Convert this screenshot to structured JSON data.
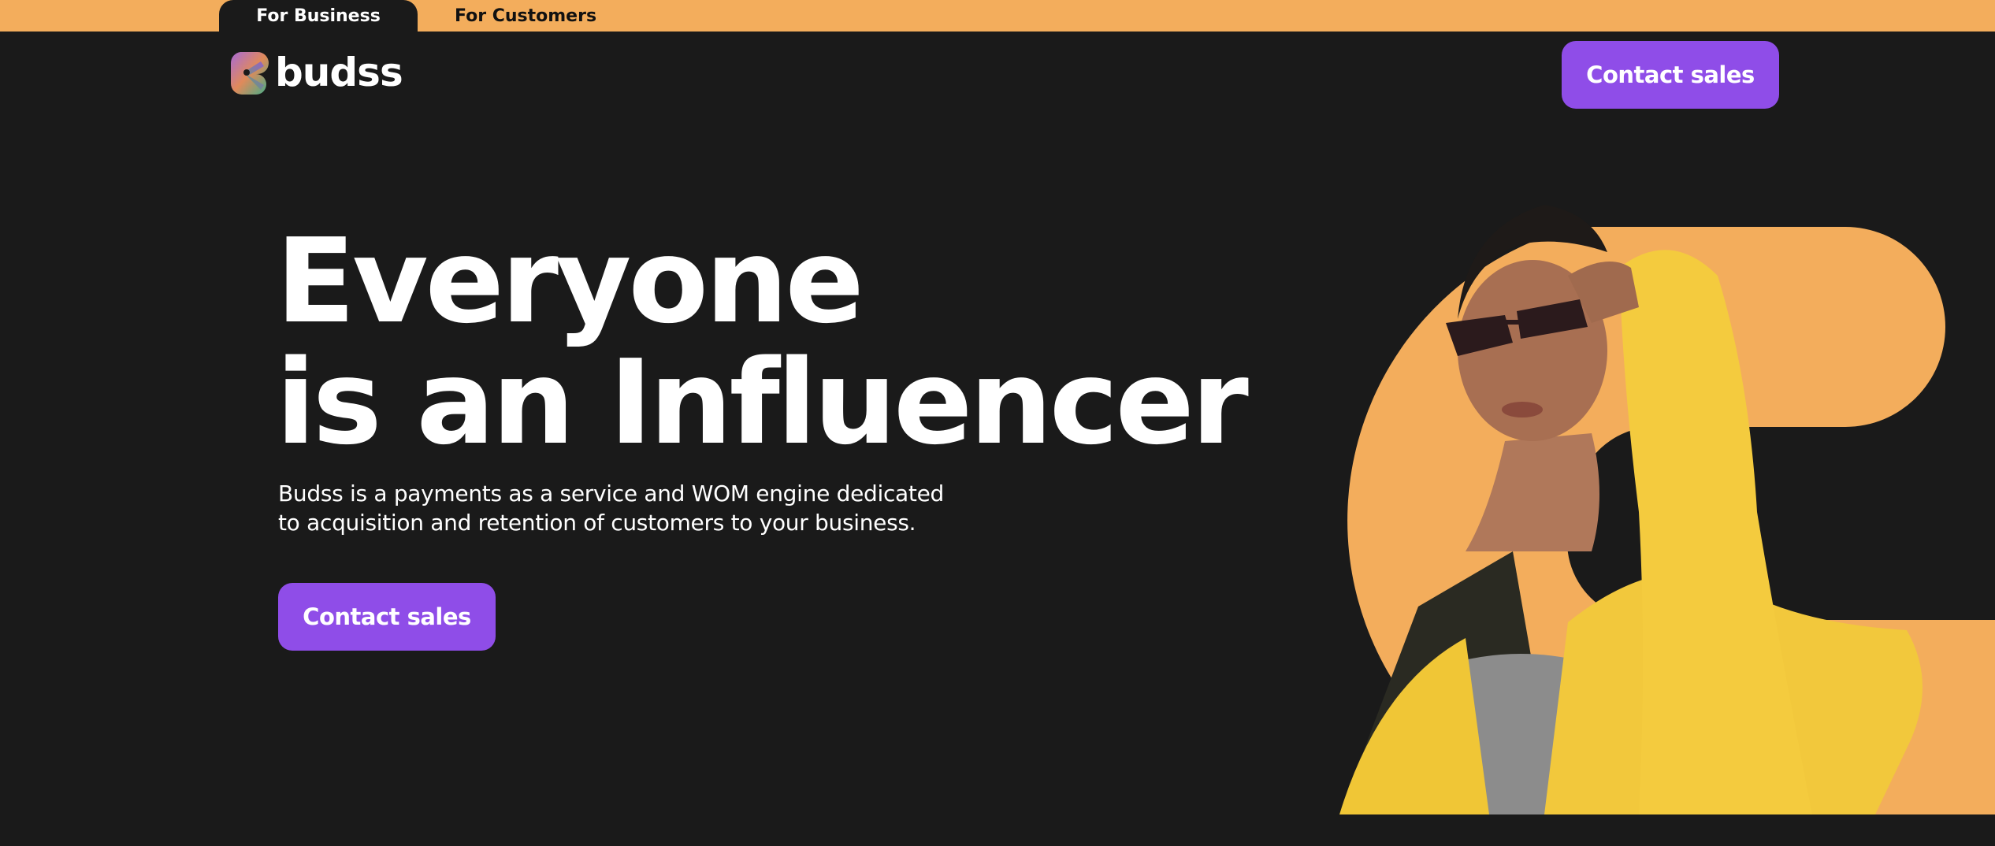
{
  "topbar": {
    "tabs": [
      {
        "label": "For Business",
        "active": true
      },
      {
        "label": "For Customers",
        "active": false
      }
    ]
  },
  "header": {
    "logo_text": "budss",
    "cta_label": "Contact sales"
  },
  "hero": {
    "headline_line1": "Everyone",
    "headline_line2": "is an Influencer",
    "subtext_line1": "Budss is a payments as a service and WOM engine dedicated",
    "subtext_line2": "to acquisition and retention of customers to your business.",
    "cta_label": "Contact sales"
  },
  "colors": {
    "background": "#1a1a1a",
    "accent_orange": "#f3ad5c",
    "button_purple": "#8f4de8",
    "text_white": "#ffffff"
  },
  "icons": {
    "logo_mark": "budss-b-logo-icon"
  }
}
